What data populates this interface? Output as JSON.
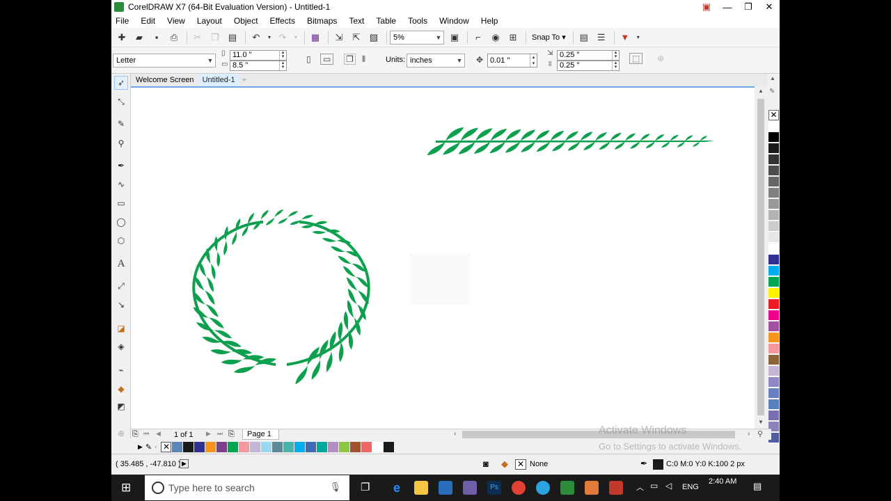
{
  "window": {
    "title": "CorelDRAW X7 (64-Bit Evaluation Version) - Untitled-1"
  },
  "menu": [
    "File",
    "Edit",
    "View",
    "Layout",
    "Object",
    "Effects",
    "Bitmaps",
    "Text",
    "Table",
    "Tools",
    "Window",
    "Help"
  ],
  "toolbar": {
    "zoom": "5%",
    "snap_to": "Snap To"
  },
  "property_bar": {
    "page_size": "Letter",
    "width": "11.0 \"",
    "height": "8.5 \"",
    "units_label": "Units:",
    "units": "inches",
    "nudge": "0.01 \"",
    "dup_x": "0.25 \"",
    "dup_y": "0.25 \""
  },
  "tabs": [
    "Welcome Screen",
    "Untitled-1"
  ],
  "tab_add": "+",
  "page_nav": {
    "count": "1 of 1",
    "page_tab": "Page 1"
  },
  "status": {
    "coords": "( 35.485 , -47.810 )",
    "fill": "None",
    "outline": "C:0 M:0 Y:0 K:100  2 px"
  },
  "watermark": {
    "line1": "Activate Windows",
    "line2": "Go to Settings to activate Windows."
  },
  "taskbar": {
    "search_placeholder": "Type here to search",
    "lang": "ENG",
    "time": "2:40 AM"
  },
  "colors": {
    "leaf": "#0ea04e",
    "palette": [
      "#ffffff",
      "#000000",
      "#1a1a1a",
      "#333333",
      "#4d4d4d",
      "#666666",
      "#808080",
      "#999999",
      "#b3b3b3",
      "#cccccc",
      "#e6e6e6",
      "#ffffff",
      "#2e3192",
      "#00aeef",
      "#00a651",
      "#fff200",
      "#ed1c24",
      "#ec008c",
      "#a0519f",
      "#f7941d",
      "#f5989d",
      "#8c6239",
      "#c2b5d6",
      "#8f87c4",
      "#6a7fbf",
      "#5a7fbf",
      "#7b6fb3",
      "#8a83b8",
      "#4f5d9e"
    ],
    "doc_palette": [
      "#5c85b8",
      "#1a1a1a",
      "#2e3192",
      "#f7941d",
      "#7b3f8c",
      "#00a651",
      "#f5989d",
      "#c2b5d6",
      "#9ad7f0",
      "#5c8a99",
      "#45b5aa",
      "#00aeef",
      "#3f6cb3",
      "#00a99d",
      "#b28fc0",
      "#8dc63f",
      "#a0522d",
      "#ee6666",
      "#ffffff",
      "#1a1a1a"
    ]
  }
}
